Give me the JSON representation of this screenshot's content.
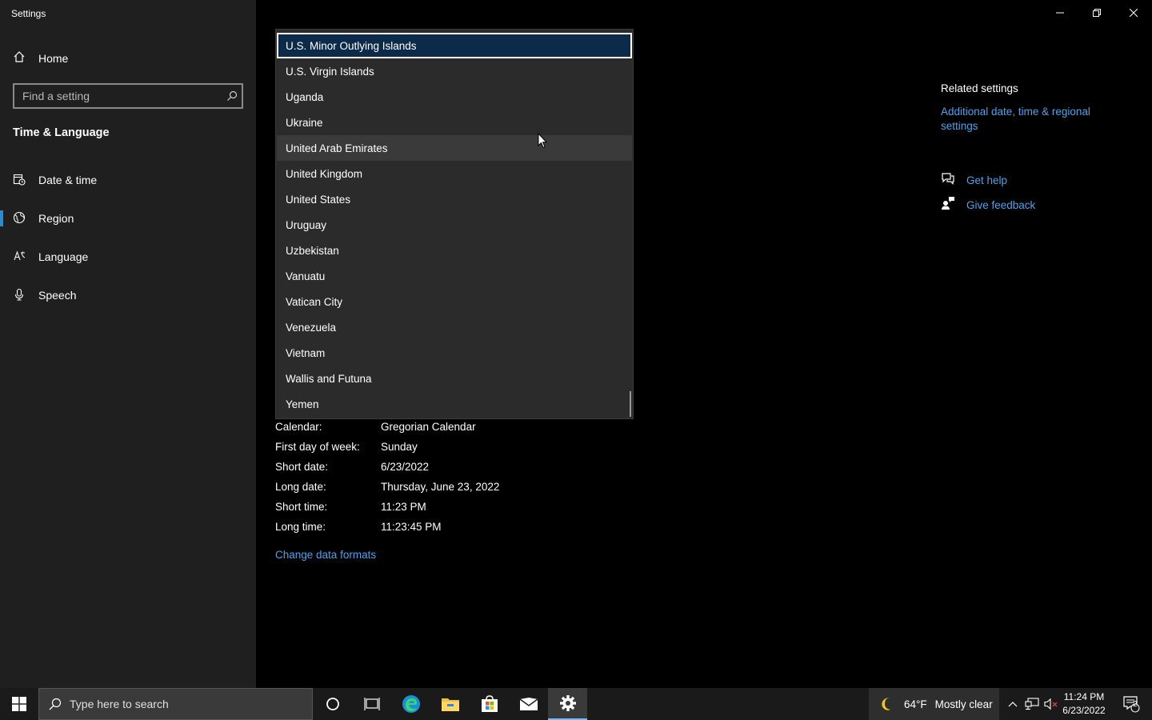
{
  "window": {
    "title": "Settings"
  },
  "sidebar": {
    "home_label": "Home",
    "search_placeholder": "Find a setting",
    "section_title": "Time & Language",
    "items": [
      {
        "label": "Date & time",
        "icon": "calendar-clock-icon"
      },
      {
        "label": "Region",
        "icon": "globe-icon",
        "active": true
      },
      {
        "label": "Language",
        "icon": "language-icon"
      },
      {
        "label": "Speech",
        "icon": "microphone-icon"
      }
    ]
  },
  "country_dropdown": {
    "options": [
      "U.S. Minor Outlying Islands",
      "U.S. Virgin Islands",
      "Uganda",
      "Ukraine",
      "United Arab Emirates",
      "United Kingdom",
      "United States",
      "Uruguay",
      "Uzbekistan",
      "Vanuatu",
      "Vatican City",
      "Venezuela",
      "Vietnam",
      "Wallis and Futuna",
      "Yemen"
    ],
    "selected": "U.S. Minor Outlying Islands",
    "hovered": "United Arab Emirates"
  },
  "regional_format": {
    "rows": [
      {
        "key": "Calendar:",
        "value": "Gregorian Calendar"
      },
      {
        "key": "First day of week:",
        "value": "Sunday"
      },
      {
        "key": "Short date:",
        "value": "6/23/2022"
      },
      {
        "key": "Long date:",
        "value": "Thursday, June 23, 2022"
      },
      {
        "key": "Short time:",
        "value": "11:23 PM"
      },
      {
        "key": "Long time:",
        "value": "11:23:45 PM"
      }
    ],
    "change_link": "Change data formats"
  },
  "related": {
    "title": "Related settings",
    "link": "Additional date, time & regional settings",
    "get_help": "Get help",
    "give_feedback": "Give feedback"
  },
  "taskbar": {
    "search_placeholder": "Type here to search",
    "weather_temp": "64°F",
    "weather_condition": "Mostly clear",
    "time": "11:24 PM",
    "date": "6/23/2022",
    "notification_count": "2"
  },
  "colors": {
    "accent": "#2a8ad4",
    "link": "#4aa3ec",
    "sidebar_bg": "#1f1f1f",
    "selected_bg": "#0c2a4a"
  }
}
